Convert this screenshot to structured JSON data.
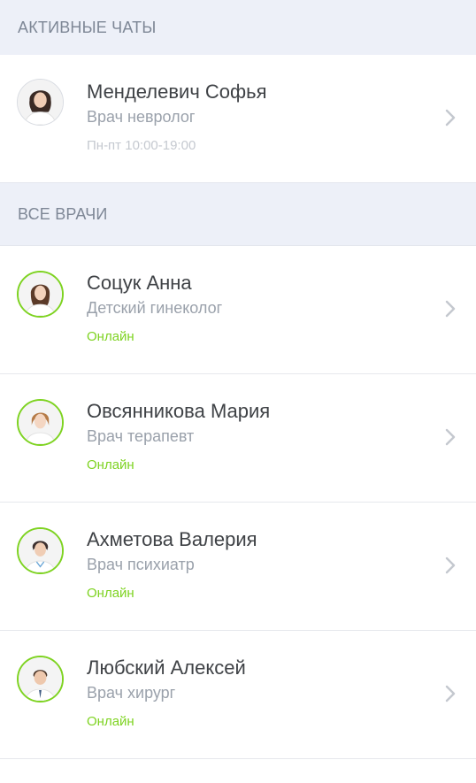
{
  "sections": {
    "active_chats": "АКТИВНЫЕ ЧАТЫ",
    "all_doctors": "ВСЕ ВРАЧИ"
  },
  "active_chats": [
    {
      "name": "Менделевич Софья",
      "role": "Врач невролог",
      "hours": "Пн-пт 10:00-19:00"
    }
  ],
  "doctors": [
    {
      "name": "Соцук Анна",
      "role": "Детский гинеколог",
      "status": "Онлайн"
    },
    {
      "name": "Овсянникова Мария",
      "role": "Врач терапевт",
      "status": "Онлайн"
    },
    {
      "name": "Ахметова Валерия",
      "role": "Врач психиатр",
      "status": "Онлайн"
    },
    {
      "name": "Любский Алексей",
      "role": "Врач хирург",
      "status": "Онлайн"
    }
  ],
  "colors": {
    "online": "#7ed321",
    "section_bg": "#edf0f8",
    "section_text": "#7e8796"
  },
  "icons": {
    "row_arrow": "chevron-right-icon"
  }
}
